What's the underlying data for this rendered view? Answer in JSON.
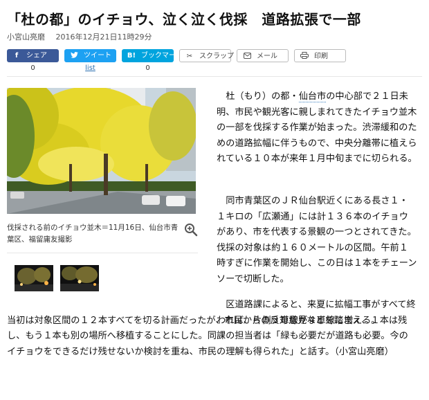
{
  "article": {
    "title": "「杜の都」のイチョウ、泣く泣く伐採　道路拡張で一部",
    "author": "小宮山亮磨",
    "date": "2016年12月21日11時29分"
  },
  "share": {
    "facebook": {
      "label": "シェア",
      "count": "0"
    },
    "twitter": {
      "label": "ツイート",
      "count": "list"
    },
    "hatena": {
      "label": "ブックマーク",
      "count": "0"
    },
    "scrap": {
      "label": "スクラップ"
    },
    "mail": {
      "label": "メール"
    },
    "print": {
      "label": "印刷"
    }
  },
  "photo": {
    "caption": "伐採される前のイチョウ並木＝11月16日、仙台市青葉区、福留庸友撮影"
  },
  "body": {
    "p1_before": "杜（もり）の都・",
    "p1_link": "仙台市",
    "p1_after": "の中心部で２１日未明、市民や観光客に親しまれてきたイチョウ並木の一部を伐採する作業が始まった。渋滞緩和のための道路拡幅に伴うもので、中央分離帯に植えられている１０本が来年１月中旬までに切られる。",
    "p2": "同市青葉区のＪＲ仙台駅近くにある長さ１・１キロの「広瀬通」には計１３６本のイチョウがあり、市を代表する景観の一つとされてきた。伐採の対象は約１６０メートルの区間。午前１時すぎに作業を開始し、この日は１本をチェーンソーで切断した。",
    "p3_first": "区道路課によると、来夏に拡幅工事がすべて終われば、片側３車線が４車線に増える。",
    "p3_rest": "当初は対象区間の１２本すべてを切る計画だったが、市民からの反対意見などを踏まえ、１本は残し、もう１本も別の場所へ移植することにした。同課の担当者は「緑も必要だが道路も必要。今のイチョウをできるだけ残せないか検討を重ね、市民の理解も得られた」と話す。（小宮山亮磨）"
  }
}
